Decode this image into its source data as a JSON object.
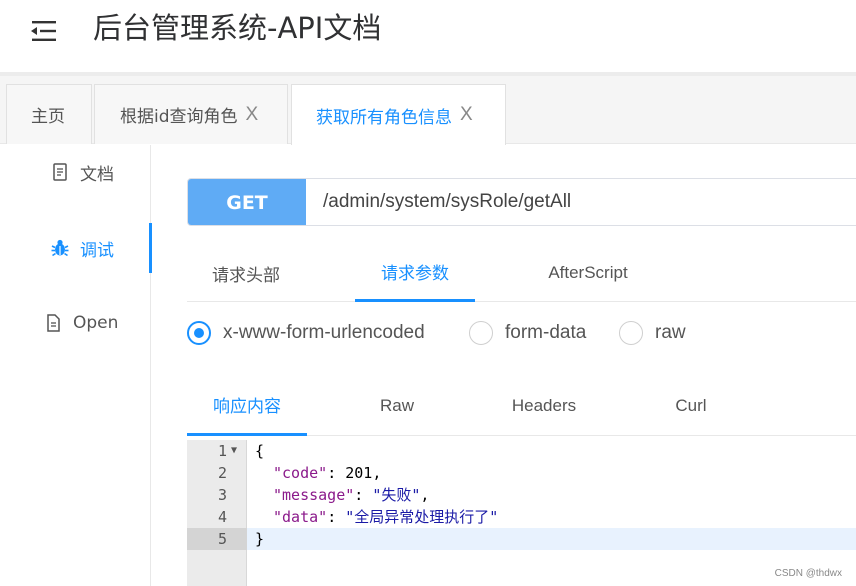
{
  "header": {
    "title": "后台管理系统-API文档",
    "menu_icon": "menu-fold-icon"
  },
  "tabs": [
    {
      "label": "主页",
      "closable": false,
      "active": false
    },
    {
      "label": "根据id查询角色",
      "closable": true,
      "active": false
    },
    {
      "label": "获取所有角色信息",
      "closable": true,
      "active": true
    }
  ],
  "tab_close_glyph": "X",
  "sidebar": {
    "items": [
      {
        "label": "文档",
        "icon": "document-icon",
        "active": false
      },
      {
        "label": "调试",
        "icon": "bug-icon",
        "active": true
      },
      {
        "label": "Open",
        "icon": "file-icon",
        "active": false
      }
    ]
  },
  "request": {
    "method": "GET",
    "url": "/admin/system/sysRole/getAll",
    "tabs": [
      {
        "label": "请求头部",
        "active": false
      },
      {
        "label": "请求参数",
        "active": true
      },
      {
        "label": "AfterScript",
        "active": false
      }
    ],
    "body_types": [
      {
        "label": "x-www-form-urlencoded",
        "checked": true
      },
      {
        "label": "form-data",
        "checked": false
      },
      {
        "label": "raw",
        "checked": false
      }
    ]
  },
  "response": {
    "tabs": [
      {
        "label": "响应内容",
        "active": true
      },
      {
        "label": "Raw",
        "active": false
      },
      {
        "label": "Headers",
        "active": false
      },
      {
        "label": "Curl",
        "active": false
      }
    ],
    "lines": [
      {
        "num": "1",
        "text": "{"
      },
      {
        "num": "2",
        "key": "\"code\"",
        "sep": ": ",
        "value": "201",
        "tail": ","
      },
      {
        "num": "3",
        "key": "\"message\"",
        "sep": ": ",
        "value": "\"失败\"",
        "tail": ","
      },
      {
        "num": "4",
        "key": "\"data\"",
        "sep": ": ",
        "value": "\"全局异常处理执行了\"",
        "tail": ""
      },
      {
        "num": "5",
        "text": "}"
      }
    ]
  },
  "watermark": "CSDN @thdwx",
  "colors": {
    "accent": "#1890ff",
    "method_bg": "#5fabf5"
  }
}
